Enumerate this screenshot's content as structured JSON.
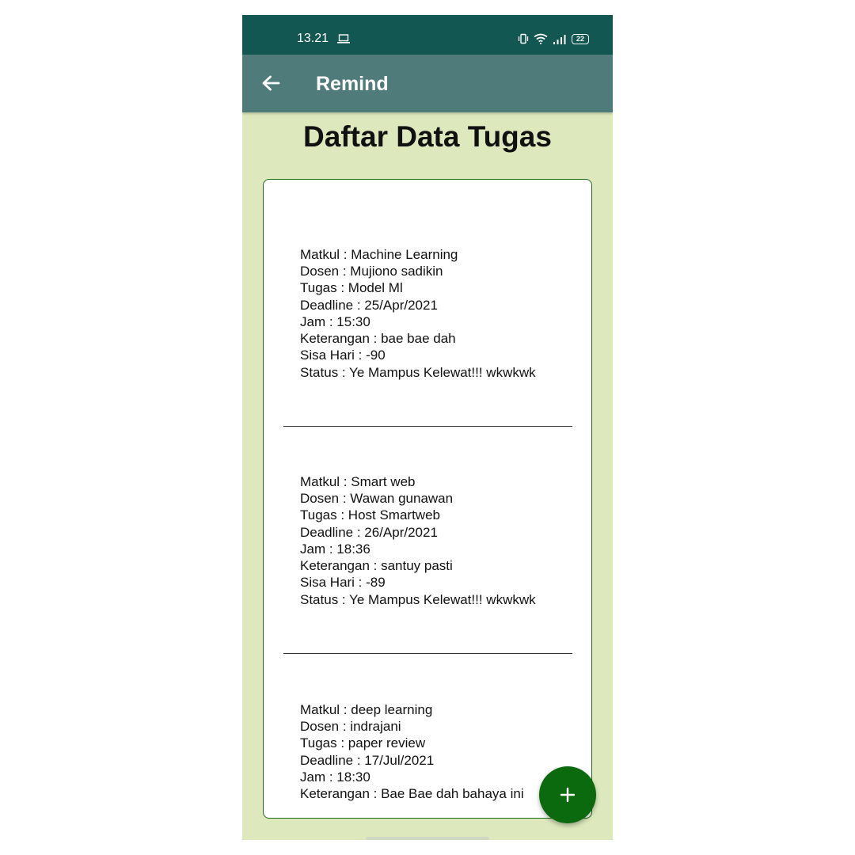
{
  "status_bar": {
    "time": "13.21",
    "battery": "22",
    "icons": [
      "laptop-icon",
      "vibrate-icon",
      "wifi-icon",
      "signal-icon",
      "battery-icon"
    ]
  },
  "app_bar": {
    "title": "Remind",
    "back_icon": "arrow-left-icon"
  },
  "page": {
    "title": "Daftar Data Tugas"
  },
  "tasks": [
    {
      "matkul": "Matkul : Machine Learning",
      "dosen": "Dosen : Mujiono sadikin",
      "tugas": "Tugas : Model Ml",
      "deadline": "Deadline : 25/Apr/2021",
      "jam": "Jam : 15:30",
      "keterangan": "Keterangan : bae bae dah",
      "sisa_hari": "Sisa Hari : -90",
      "status": "Status : Ye Mampus Kelewat!!! wkwkwk"
    },
    {
      "matkul": "Matkul : Smart web",
      "dosen": "Dosen : Wawan gunawan",
      "tugas": "Tugas : Host Smartweb",
      "deadline": "Deadline : 26/Apr/2021",
      "jam": "Jam : 18:36",
      "keterangan": "Keterangan : santuy pasti",
      "sisa_hari": "Sisa Hari : -89",
      "status": "Status : Ye Mampus Kelewat!!! wkwkwk"
    },
    {
      "matkul": "Matkul : deep learning",
      "dosen": "Dosen : indrajani",
      "tugas": "Tugas : paper review",
      "deadline": "Deadline : 17/Jul/2021",
      "jam": "Jam : 18:30",
      "keterangan": "Keterangan : Bae Bae dah bahaya ini"
    }
  ],
  "fab": {
    "icon": "plus-icon",
    "label": "+"
  },
  "colors": {
    "status_bar": "#125752",
    "app_bar": "#4f7c7b",
    "background": "#dde9bd",
    "card_border": "#1d6b1d",
    "fab": "#0a6a0d"
  }
}
